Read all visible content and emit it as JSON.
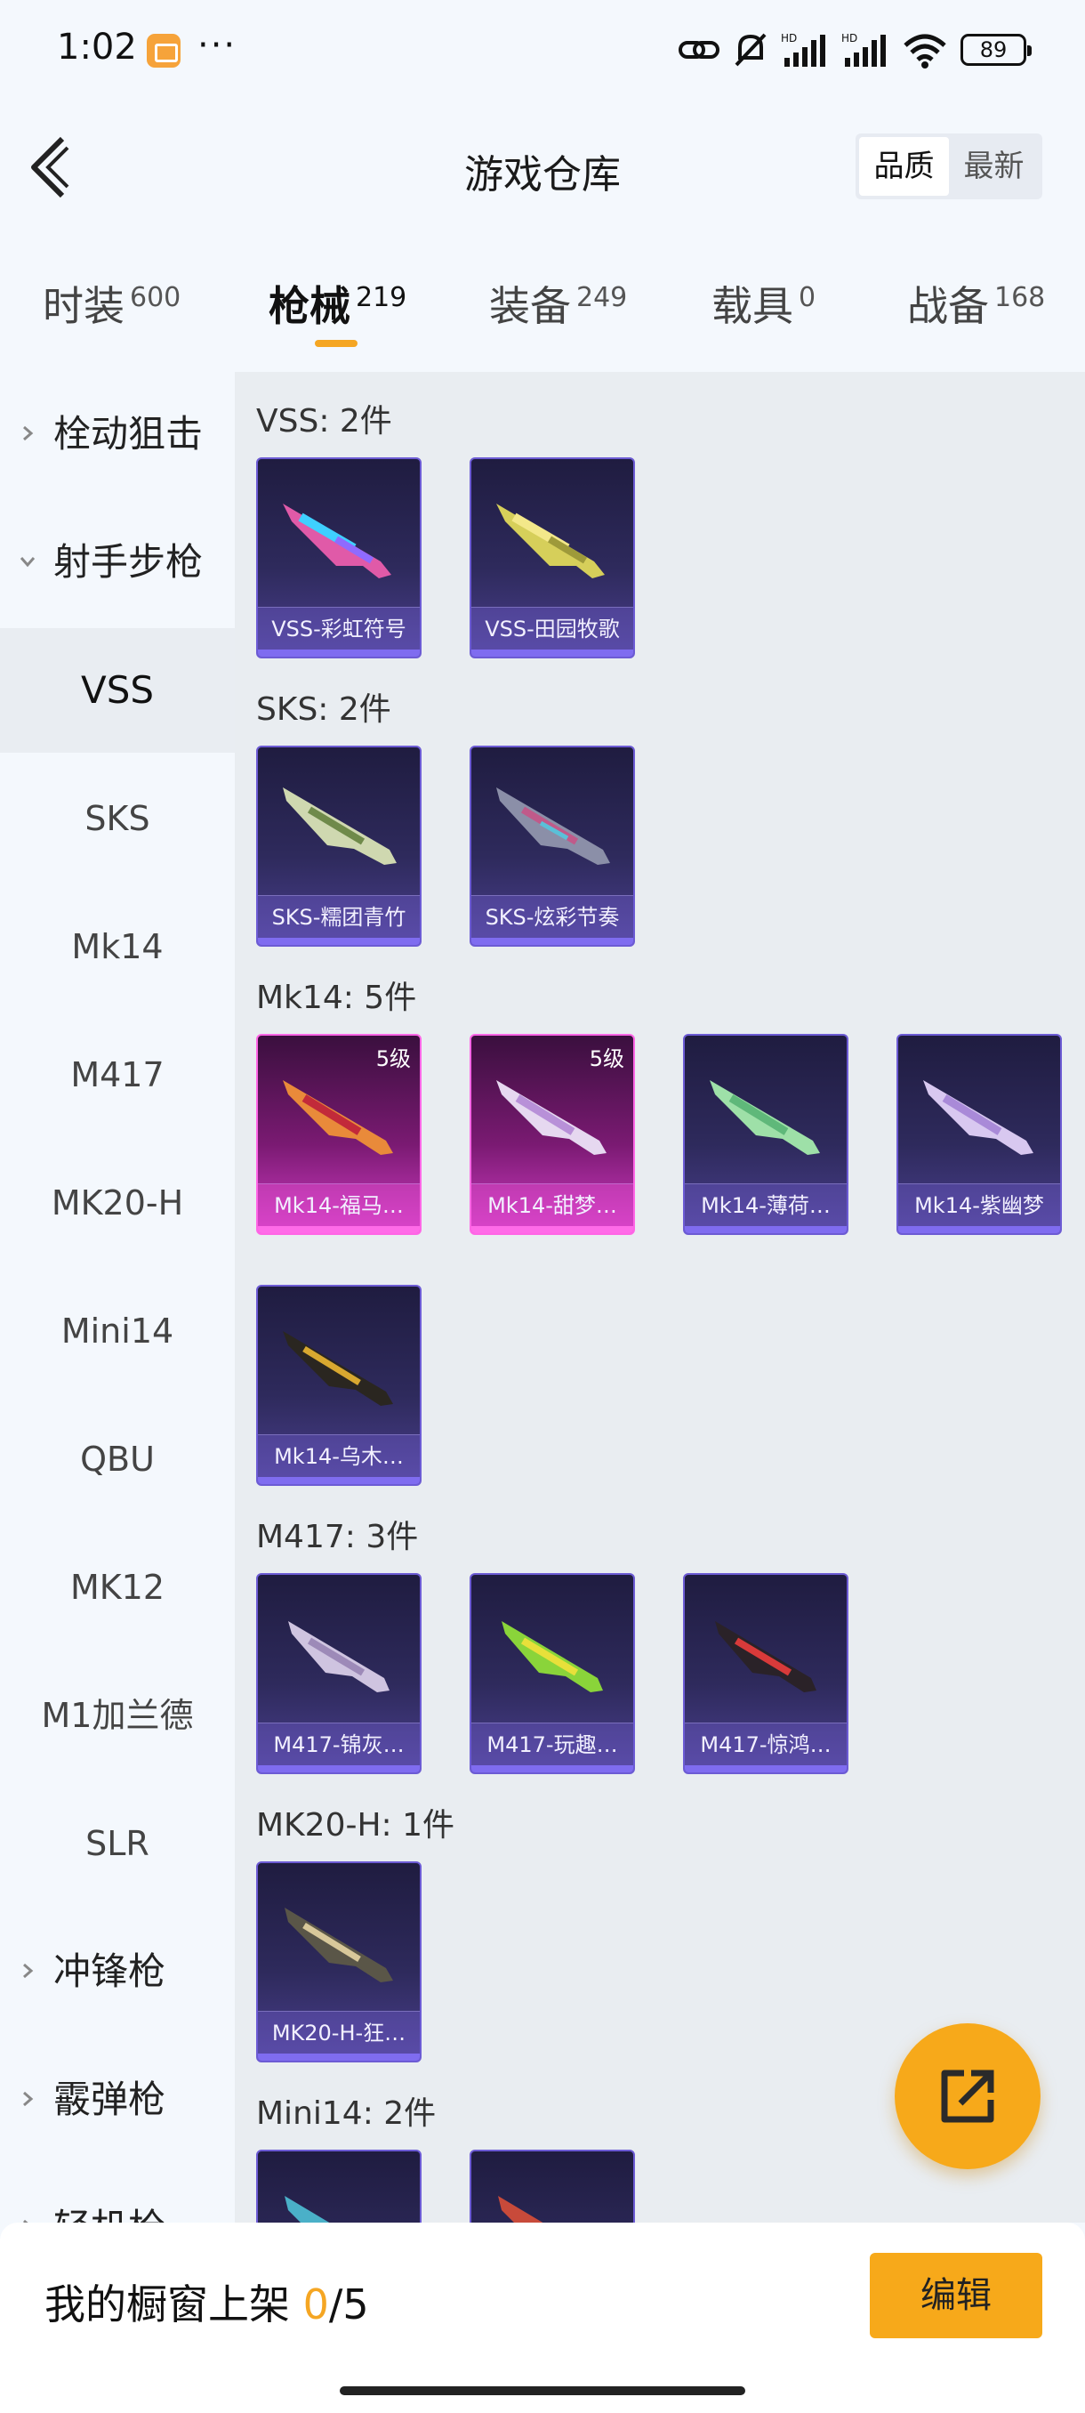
{
  "status_bar": {
    "time": "1:02",
    "more": "···",
    "battery": "89"
  },
  "header": {
    "title": "游戏仓库",
    "sort": [
      "品质",
      "最新"
    ]
  },
  "tabs": [
    {
      "label": "时装",
      "count": "600"
    },
    {
      "label": "枪械",
      "count": "219"
    },
    {
      "label": "装备",
      "count": "249"
    },
    {
      "label": "载具",
      "count": "0"
    },
    {
      "label": "战备",
      "count": "168"
    }
  ],
  "sidebar": {
    "bolt_sniper": "栓动狙击",
    "marksman": "射手步枪",
    "items": [
      "VSS",
      "SKS",
      "Mk14",
      "M417",
      "MK20-H",
      "Mini14",
      "QBU",
      "MK12",
      "M1加兰德",
      "SLR"
    ],
    "smg": "冲锋枪",
    "shotgun": "霰弹枪",
    "lmg": "轻机枪"
  },
  "sections": [
    {
      "title": "VSS: 2件",
      "cards": [
        "VSS-彩虹符号",
        "VSS-田园牧歌"
      ]
    },
    {
      "title": "SKS: 2件",
      "cards": [
        "SKS-糯团青竹",
        "SKS-炫彩节奏"
      ]
    },
    {
      "title": "Mk14: 5件",
      "cards": [
        "Mk14-福马…",
        "Mk14-甜梦…",
        "Mk14-薄荷…",
        "Mk14-紫幽梦",
        "Mk14-乌木…"
      ],
      "badge": "5级"
    },
    {
      "title": "M417: 3件",
      "cards": [
        "M417-锦灰…",
        "M417-玩趣…",
        "M417-惊鸿…"
      ]
    },
    {
      "title": "MK20-H: 1件",
      "cards": [
        "MK20-H-狂…"
      ]
    },
    {
      "title": "Mini14: 2件"
    }
  ],
  "bottom": {
    "label": "我的橱窗上架 ",
    "current": "0",
    "total": "/5",
    "edit": "编辑"
  },
  "colors": {
    "accent": "#f7a91a",
    "legendary": "#ff66e6",
    "epic": "#6c5bd4"
  }
}
